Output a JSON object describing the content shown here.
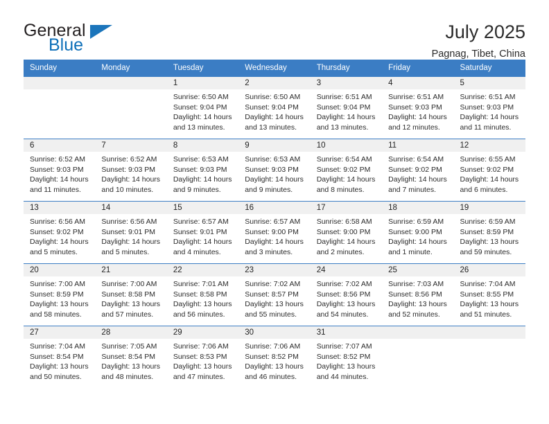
{
  "brand": {
    "name_part1": "General",
    "name_part2": "Blue",
    "accent_color": "#1b75bb"
  },
  "header": {
    "month_title": "July 2025",
    "location": "Pagnag, Tibet, China",
    "header_bg_color": "#3b7dc4",
    "daynum_bg_color": "#f0f0f0"
  },
  "weekday_headers": [
    "Sunday",
    "Monday",
    "Tuesday",
    "Wednesday",
    "Thursday",
    "Friday",
    "Saturday"
  ],
  "weeks": [
    [
      {
        "day": "",
        "empty": true
      },
      {
        "day": "",
        "empty": true
      },
      {
        "day": "1",
        "sunrise": "Sunrise: 6:50 AM",
        "sunset": "Sunset: 9:04 PM",
        "daylight": "Daylight: 14 hours and 13 minutes."
      },
      {
        "day": "2",
        "sunrise": "Sunrise: 6:50 AM",
        "sunset": "Sunset: 9:04 PM",
        "daylight": "Daylight: 14 hours and 13 minutes."
      },
      {
        "day": "3",
        "sunrise": "Sunrise: 6:51 AM",
        "sunset": "Sunset: 9:04 PM",
        "daylight": "Daylight: 14 hours and 13 minutes."
      },
      {
        "day": "4",
        "sunrise": "Sunrise: 6:51 AM",
        "sunset": "Sunset: 9:03 PM",
        "daylight": "Daylight: 14 hours and 12 minutes."
      },
      {
        "day": "5",
        "sunrise": "Sunrise: 6:51 AM",
        "sunset": "Sunset: 9:03 PM",
        "daylight": "Daylight: 14 hours and 11 minutes."
      }
    ],
    [
      {
        "day": "6",
        "sunrise": "Sunrise: 6:52 AM",
        "sunset": "Sunset: 9:03 PM",
        "daylight": "Daylight: 14 hours and 11 minutes."
      },
      {
        "day": "7",
        "sunrise": "Sunrise: 6:52 AM",
        "sunset": "Sunset: 9:03 PM",
        "daylight": "Daylight: 14 hours and 10 minutes."
      },
      {
        "day": "8",
        "sunrise": "Sunrise: 6:53 AM",
        "sunset": "Sunset: 9:03 PM",
        "daylight": "Daylight: 14 hours and 9 minutes."
      },
      {
        "day": "9",
        "sunrise": "Sunrise: 6:53 AM",
        "sunset": "Sunset: 9:03 PM",
        "daylight": "Daylight: 14 hours and 9 minutes."
      },
      {
        "day": "10",
        "sunrise": "Sunrise: 6:54 AM",
        "sunset": "Sunset: 9:02 PM",
        "daylight": "Daylight: 14 hours and 8 minutes."
      },
      {
        "day": "11",
        "sunrise": "Sunrise: 6:54 AM",
        "sunset": "Sunset: 9:02 PM",
        "daylight": "Daylight: 14 hours and 7 minutes."
      },
      {
        "day": "12",
        "sunrise": "Sunrise: 6:55 AM",
        "sunset": "Sunset: 9:02 PM",
        "daylight": "Daylight: 14 hours and 6 minutes."
      }
    ],
    [
      {
        "day": "13",
        "sunrise": "Sunrise: 6:56 AM",
        "sunset": "Sunset: 9:02 PM",
        "daylight": "Daylight: 14 hours and 5 minutes."
      },
      {
        "day": "14",
        "sunrise": "Sunrise: 6:56 AM",
        "sunset": "Sunset: 9:01 PM",
        "daylight": "Daylight: 14 hours and 5 minutes."
      },
      {
        "day": "15",
        "sunrise": "Sunrise: 6:57 AM",
        "sunset": "Sunset: 9:01 PM",
        "daylight": "Daylight: 14 hours and 4 minutes."
      },
      {
        "day": "16",
        "sunrise": "Sunrise: 6:57 AM",
        "sunset": "Sunset: 9:00 PM",
        "daylight": "Daylight: 14 hours and 3 minutes."
      },
      {
        "day": "17",
        "sunrise": "Sunrise: 6:58 AM",
        "sunset": "Sunset: 9:00 PM",
        "daylight": "Daylight: 14 hours and 2 minutes."
      },
      {
        "day": "18",
        "sunrise": "Sunrise: 6:59 AM",
        "sunset": "Sunset: 9:00 PM",
        "daylight": "Daylight: 14 hours and 1 minute."
      },
      {
        "day": "19",
        "sunrise": "Sunrise: 6:59 AM",
        "sunset": "Sunset: 8:59 PM",
        "daylight": "Daylight: 13 hours and 59 minutes."
      }
    ],
    [
      {
        "day": "20",
        "sunrise": "Sunrise: 7:00 AM",
        "sunset": "Sunset: 8:59 PM",
        "daylight": "Daylight: 13 hours and 58 minutes."
      },
      {
        "day": "21",
        "sunrise": "Sunrise: 7:00 AM",
        "sunset": "Sunset: 8:58 PM",
        "daylight": "Daylight: 13 hours and 57 minutes."
      },
      {
        "day": "22",
        "sunrise": "Sunrise: 7:01 AM",
        "sunset": "Sunset: 8:58 PM",
        "daylight": "Daylight: 13 hours and 56 minutes."
      },
      {
        "day": "23",
        "sunrise": "Sunrise: 7:02 AM",
        "sunset": "Sunset: 8:57 PM",
        "daylight": "Daylight: 13 hours and 55 minutes."
      },
      {
        "day": "24",
        "sunrise": "Sunrise: 7:02 AM",
        "sunset": "Sunset: 8:56 PM",
        "daylight": "Daylight: 13 hours and 54 minutes."
      },
      {
        "day": "25",
        "sunrise": "Sunrise: 7:03 AM",
        "sunset": "Sunset: 8:56 PM",
        "daylight": "Daylight: 13 hours and 52 minutes."
      },
      {
        "day": "26",
        "sunrise": "Sunrise: 7:04 AM",
        "sunset": "Sunset: 8:55 PM",
        "daylight": "Daylight: 13 hours and 51 minutes."
      }
    ],
    [
      {
        "day": "27",
        "sunrise": "Sunrise: 7:04 AM",
        "sunset": "Sunset: 8:54 PM",
        "daylight": "Daylight: 13 hours and 50 minutes."
      },
      {
        "day": "28",
        "sunrise": "Sunrise: 7:05 AM",
        "sunset": "Sunset: 8:54 PM",
        "daylight": "Daylight: 13 hours and 48 minutes."
      },
      {
        "day": "29",
        "sunrise": "Sunrise: 7:06 AM",
        "sunset": "Sunset: 8:53 PM",
        "daylight": "Daylight: 13 hours and 47 minutes."
      },
      {
        "day": "30",
        "sunrise": "Sunrise: 7:06 AM",
        "sunset": "Sunset: 8:52 PM",
        "daylight": "Daylight: 13 hours and 46 minutes."
      },
      {
        "day": "31",
        "sunrise": "Sunrise: 7:07 AM",
        "sunset": "Sunset: 8:52 PM",
        "daylight": "Daylight: 13 hours and 44 minutes."
      },
      {
        "day": "",
        "empty": true
      },
      {
        "day": "",
        "empty": true
      }
    ]
  ]
}
